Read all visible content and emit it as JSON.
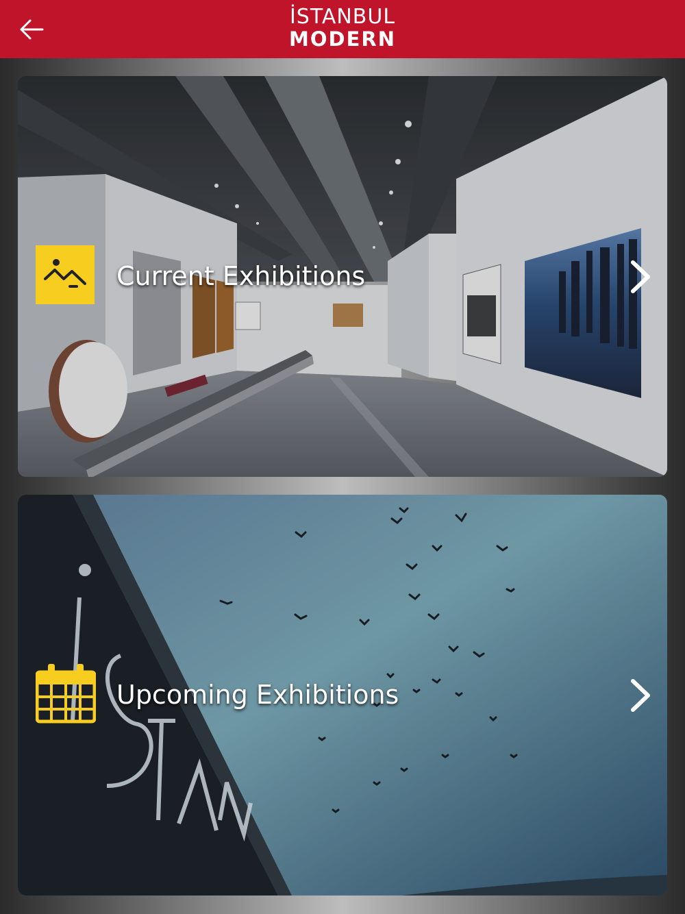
{
  "header": {
    "back_icon": "arrow-left-icon",
    "logo_line1": "İSTANBUL",
    "logo_line2": "MODERN",
    "brand_color": "#c0142b"
  },
  "cards": [
    {
      "label": "Current Exhibitions",
      "icon": "image-icon",
      "icon_color": "#f7ce1f",
      "chevron_icon": "chevron-right-icon"
    },
    {
      "label": "Upcoming Exhibitions",
      "icon": "calendar-icon",
      "icon_color": "#f7ce1f",
      "chevron_icon": "chevron-right-icon"
    }
  ],
  "upcoming_photo_sign_text": "İSTANBUL MODERN"
}
